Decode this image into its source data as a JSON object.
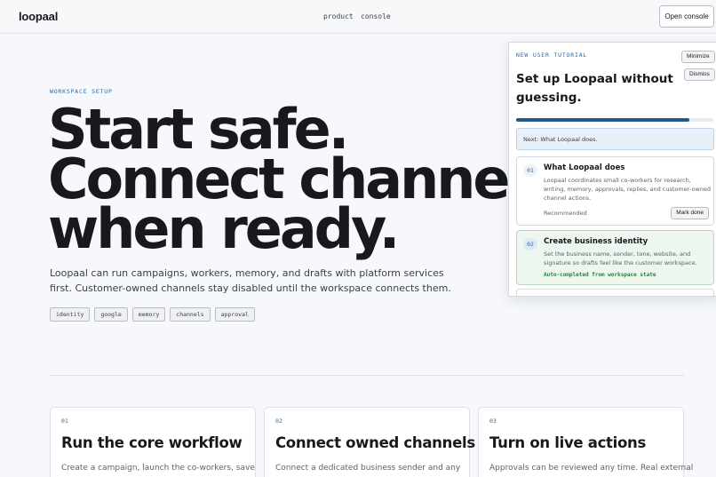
{
  "header": {
    "logo": "loopaal",
    "nav": [
      "product",
      "console"
    ],
    "cta": "Open console"
  },
  "hero": {
    "eyebrow": "WORKSPACE SETUP",
    "headline": [
      "Start safe.",
      "Connect channels",
      "when ready."
    ],
    "subcopy": "Loopaal can run campaigns, workers, memory, and drafts with platform services first. Customer-owned channels stay disabled until the workspace connects them.",
    "tags": [
      "identity",
      "google",
      "memory",
      "channels",
      "approval"
    ]
  },
  "steps": [
    {
      "num": "01",
      "title": "Run the core workflow",
      "desc": "Create a campaign, launch the co-workers, save"
    },
    {
      "num": "02",
      "title": "Connect owned channels",
      "desc": "Connect a dedicated business sender and any"
    },
    {
      "num": "03",
      "title": "Turn on live actions",
      "desc": "Approvals can be reviewed any time. Real external"
    }
  ],
  "tutorial": {
    "eyebrow": "NEW USER TUTORIAL",
    "minimize": "Minimize",
    "dismiss": "Dismiss",
    "title": "Set up Loopaal without guessing.",
    "progress": 0.88,
    "next": "Next: What Loopaal does.",
    "items": [
      {
        "num": "01",
        "title": "What Loopaal does",
        "desc": "Loopaal coordinates small co-workers for research, writing, memory, approvals, replies, and customer-owned channel actions.",
        "status": "Recommended",
        "action": "Mark done"
      },
      {
        "num": "02",
        "title": "Create business identity",
        "desc": "Set the business name, sender, tone, website, and signature so drafts feel like the customer workspace.",
        "status": "Auto-completed from workspace state"
      }
    ]
  },
  "colors": {
    "accent": "#2c6aa6",
    "progress": "#1f5a8a",
    "success": "#2e7d3e",
    "background": "#f6f8fb"
  }
}
